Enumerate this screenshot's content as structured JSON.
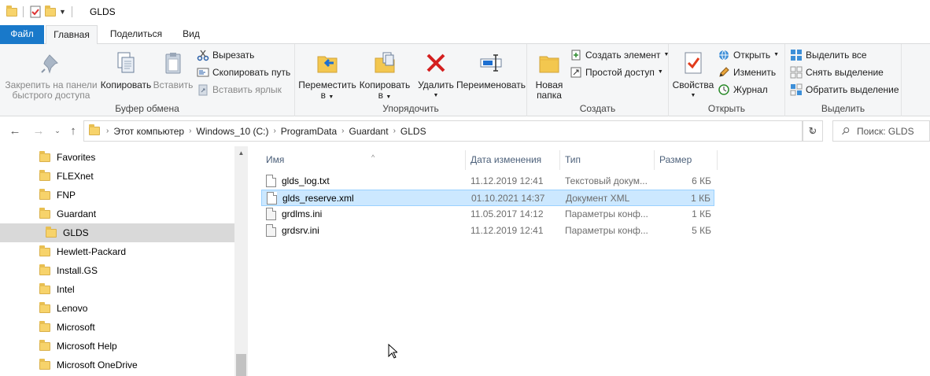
{
  "window": {
    "title": "GLDS"
  },
  "tabs": {
    "file": "Файл",
    "home": "Главная",
    "share": "Поделиться",
    "view": "Вид"
  },
  "ribbon": {
    "clipboard": {
      "label": "Буфер обмена",
      "pin": "Закрепить на панели быстрого доступа",
      "pin_line1": "Закрепить на панели",
      "pin_line2": "быстрого доступа",
      "copy": "Копировать",
      "paste": "Вставить",
      "cut": "Вырезать",
      "copy_path": "Скопировать путь",
      "paste_shortcut": "Вставить ярлык"
    },
    "organize": {
      "label": "Упорядочить",
      "move_line1": "Переместить",
      "move_line2": "в",
      "copy_line1": "Копировать",
      "copy_line2": "в",
      "delete": "Удалить",
      "rename": "Переименовать"
    },
    "create": {
      "label": "Создать",
      "new_folder_line1": "Новая",
      "new_folder_line2": "папка",
      "new_item": "Создать элемент",
      "easy_access": "Простой доступ"
    },
    "open": {
      "label": "Открыть",
      "properties": "Свойства",
      "open": "Открыть",
      "edit": "Изменить",
      "history": "Журнал"
    },
    "select": {
      "label": "Выделить",
      "select_all": "Выделить все",
      "select_none": "Снять выделение",
      "invert": "Обратить выделение"
    }
  },
  "address": {
    "crumbs": [
      "Этот компьютер",
      "Windows_10 (C:)",
      "ProgramData",
      "Guardant",
      "GLDS"
    ],
    "search_placeholder": "Поиск: GLDS"
  },
  "nav": {
    "items": [
      {
        "label": "Favorites",
        "selected": false,
        "indent": 0
      },
      {
        "label": "FLEXnet",
        "selected": false,
        "indent": 0
      },
      {
        "label": "FNP",
        "selected": false,
        "indent": 0
      },
      {
        "label": "Guardant",
        "selected": false,
        "indent": 0
      },
      {
        "label": "GLDS",
        "selected": true,
        "indent": 1
      },
      {
        "label": "Hewlett-Packard",
        "selected": false,
        "indent": 0
      },
      {
        "label": "Install.GS",
        "selected": false,
        "indent": 0
      },
      {
        "label": "Intel",
        "selected": false,
        "indent": 0
      },
      {
        "label": "Lenovo",
        "selected": false,
        "indent": 0
      },
      {
        "label": "Microsoft",
        "selected": false,
        "indent": 0
      },
      {
        "label": "Microsoft Help",
        "selected": false,
        "indent": 0
      },
      {
        "label": "Microsoft OneDrive",
        "selected": false,
        "indent": 0
      }
    ]
  },
  "files": {
    "columns": {
      "name": "Имя",
      "date": "Дата изменения",
      "type": "Тип",
      "size": "Размер"
    },
    "rows": [
      {
        "name": "glds_log.txt",
        "date": "11.12.2019 12:41",
        "type": "Текстовый докум...",
        "size": "6 КБ",
        "icon": "text-file-icon",
        "selected": false
      },
      {
        "name": "glds_reserve.xml",
        "date": "01.10.2021 14:37",
        "type": "Документ XML",
        "size": "1 КБ",
        "icon": "xml-file-icon",
        "selected": true
      },
      {
        "name": "grdlms.ini",
        "date": "11.05.2017 14:12",
        "type": "Параметры конф...",
        "size": "1 КБ",
        "icon": "ini-file-icon",
        "selected": false
      },
      {
        "name": "grdsrv.ini",
        "date": "11.12.2019 12:41",
        "type": "Параметры конф...",
        "size": "5 КБ",
        "icon": "ini-file-icon",
        "selected": false
      }
    ]
  }
}
